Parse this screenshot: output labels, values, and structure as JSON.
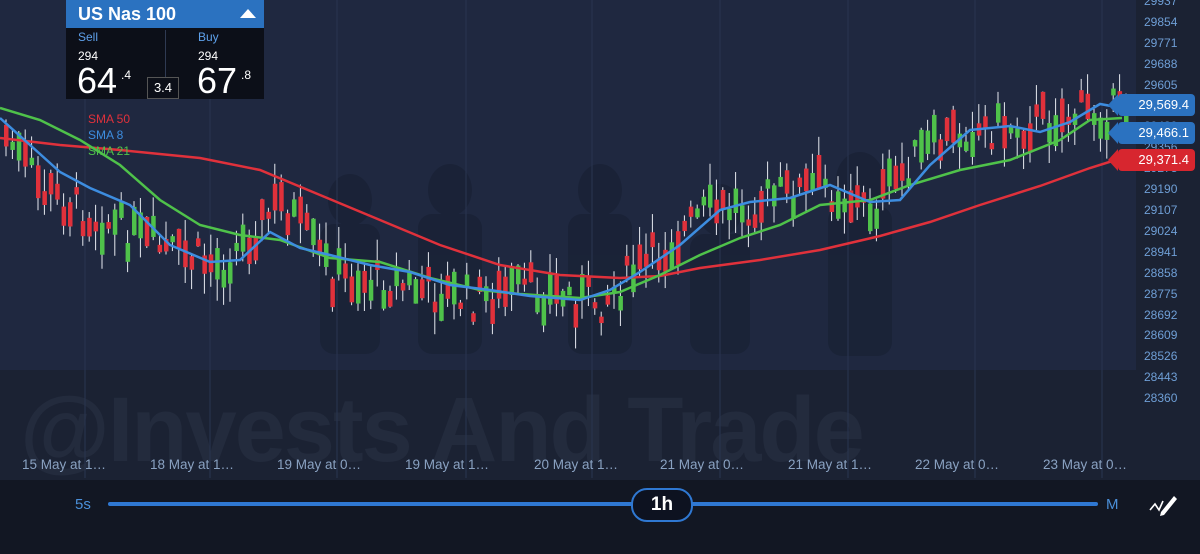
{
  "instrument": {
    "name": "US Nas 100",
    "sell": {
      "label": "Sell",
      "prefix": "294",
      "main": "64",
      "fraction": ".4"
    },
    "buy": {
      "label": "Buy",
      "prefix": "294",
      "main": "67",
      "fraction": ".8"
    },
    "spread": "3.4"
  },
  "legend": [
    {
      "label": "SMA 50",
      "color": "#e0313b"
    },
    {
      "label": "SMA 8",
      "color": "#3d8de0"
    },
    {
      "label": "SMA 21",
      "color": "#4fc24a"
    }
  ],
  "price_axis": [
    "29937",
    "29854",
    "29771",
    "29688",
    "29605",
    "29522",
    "29439",
    "29356",
    "29273",
    "29190",
    "29107",
    "29024",
    "28941",
    "28858",
    "28775",
    "28692",
    "28609",
    "28526",
    "28443",
    "28360"
  ],
  "price_markers": [
    {
      "value": "29,569.4",
      "color": "#2b72c0"
    },
    {
      "value": "29,466.1",
      "color": "#2b72c0"
    },
    {
      "value": "29,371.4",
      "color": "#d7262f"
    }
  ],
  "time_axis": [
    "15 May at 1…",
    "18 May at 1…",
    "19 May at 0…",
    "19 May at 1…",
    "20 May at 1…",
    "21 May at 0…",
    "21 May at 1…",
    "22 May at 0…",
    "23 May at 0…"
  ],
  "timeframe": {
    "min_label": "5s",
    "current": "1h",
    "max_label": "M"
  },
  "watermark": "@Invests And Trade",
  "icons": {
    "trade_toggle": "caret-up-icon",
    "draw": "pen-icon"
  },
  "colors": {
    "up": "#4fc24a",
    "down": "#e0313b",
    "accent": "#2b72c0"
  }
}
